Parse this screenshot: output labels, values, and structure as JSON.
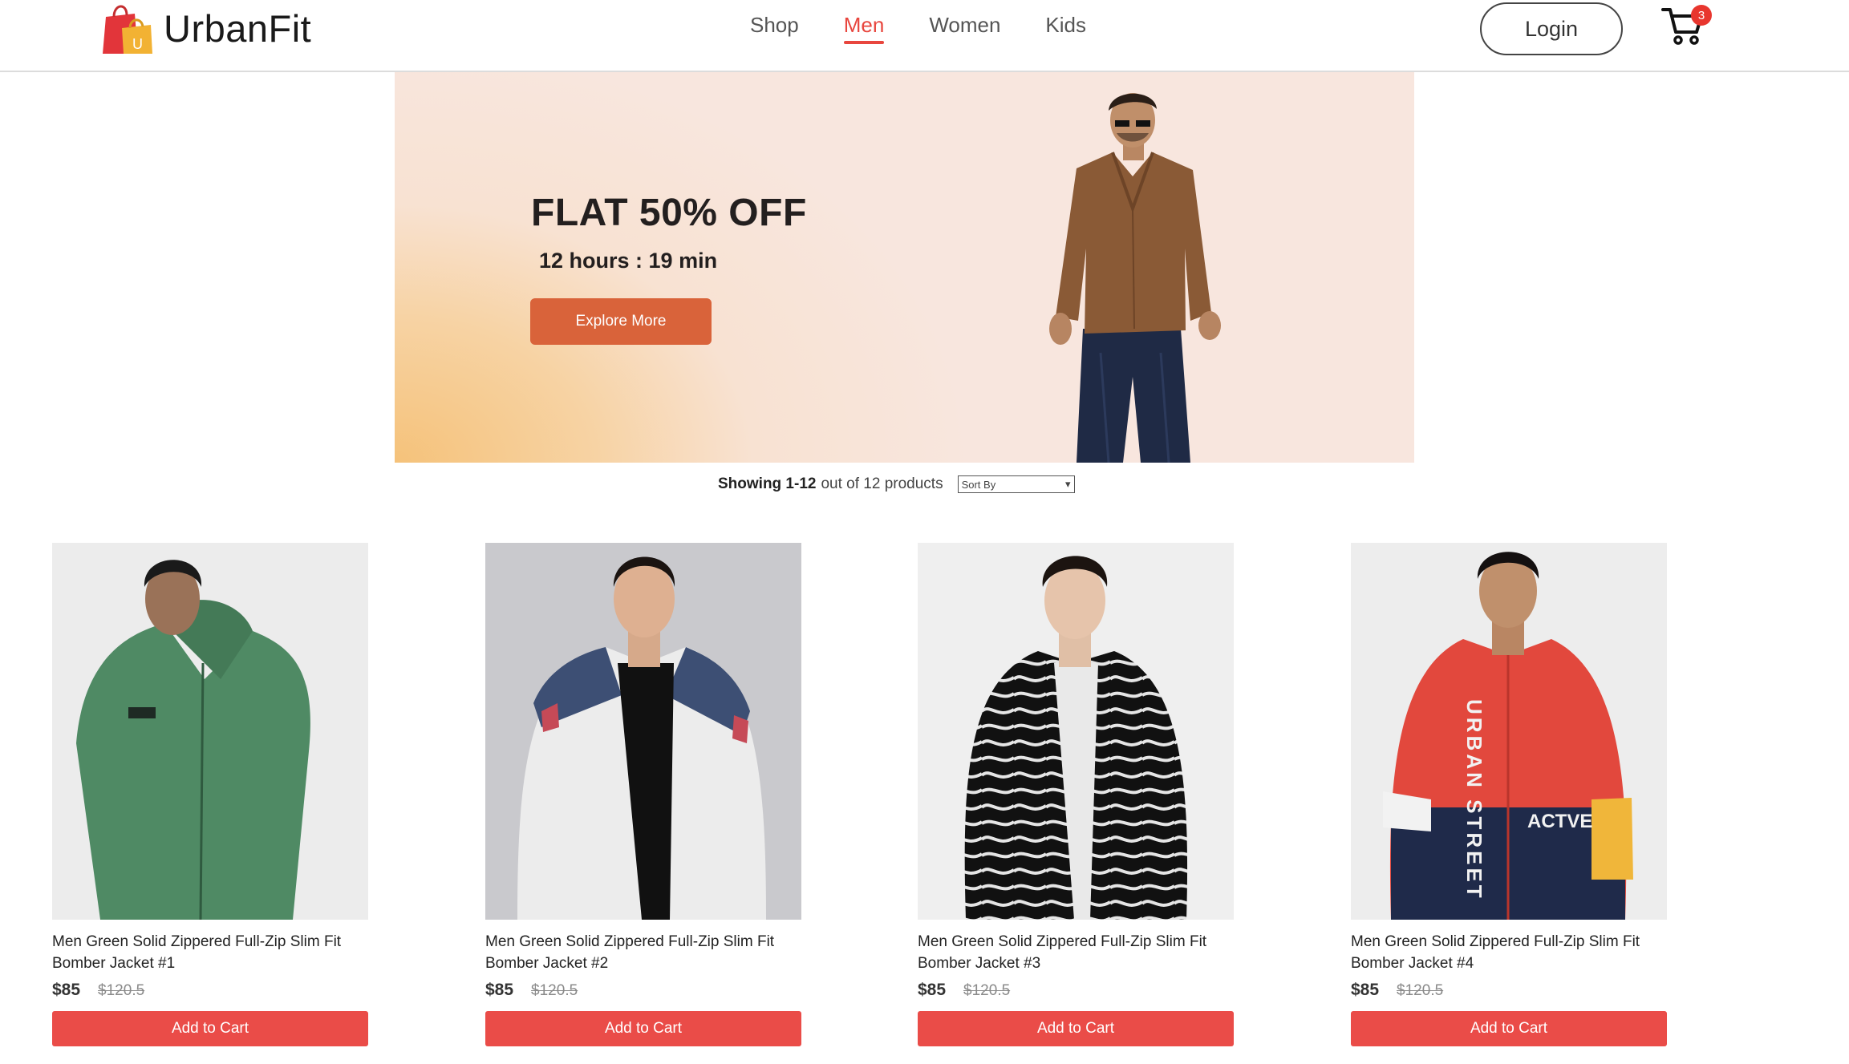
{
  "header": {
    "brand": "UrbanFit",
    "brand_logo_letter": "U",
    "nav": [
      {
        "label": "Shop",
        "active": false
      },
      {
        "label": "Men",
        "active": true
      },
      {
        "label": "Women",
        "active": false
      },
      {
        "label": "Kids",
        "active": false
      }
    ],
    "login_label": "Login",
    "cart_count": "3"
  },
  "banner": {
    "title": "FLAT 50% OFF",
    "timer": "12 hours : 19 min",
    "cta_label": "Explore More"
  },
  "results": {
    "range_label": "Showing 1-12",
    "total_label": "out of 12 products",
    "sort_label": "Sort By"
  },
  "products": [
    {
      "name": "Men Green Solid Zippered Full-Zip Slim Fit Bomber Jacket #1",
      "price": "$85",
      "old_price": "$120.5",
      "add_label": "Add to Cart"
    },
    {
      "name": "Men Green Solid Zippered Full-Zip Slim Fit Bomber Jacket #2",
      "price": "$85",
      "old_price": "$120.5",
      "add_label": "Add to Cart"
    },
    {
      "name": "Men Green Solid Zippered Full-Zip Slim Fit Bomber Jacket #3",
      "price": "$85",
      "old_price": "$120.5",
      "add_label": "Add to Cart"
    },
    {
      "name": "Men Green Solid Zippered Full-Zip Slim Fit Bomber Jacket #4",
      "price": "$85",
      "old_price": "$120.5",
      "add_label": "Add to Cart",
      "print_text": "URBAN STREET",
      "print_text_2": "ACTVE"
    }
  ],
  "colors": {
    "accent": "#e8463e",
    "button": "#ea4c48",
    "banner_cta": "#d9633a"
  }
}
